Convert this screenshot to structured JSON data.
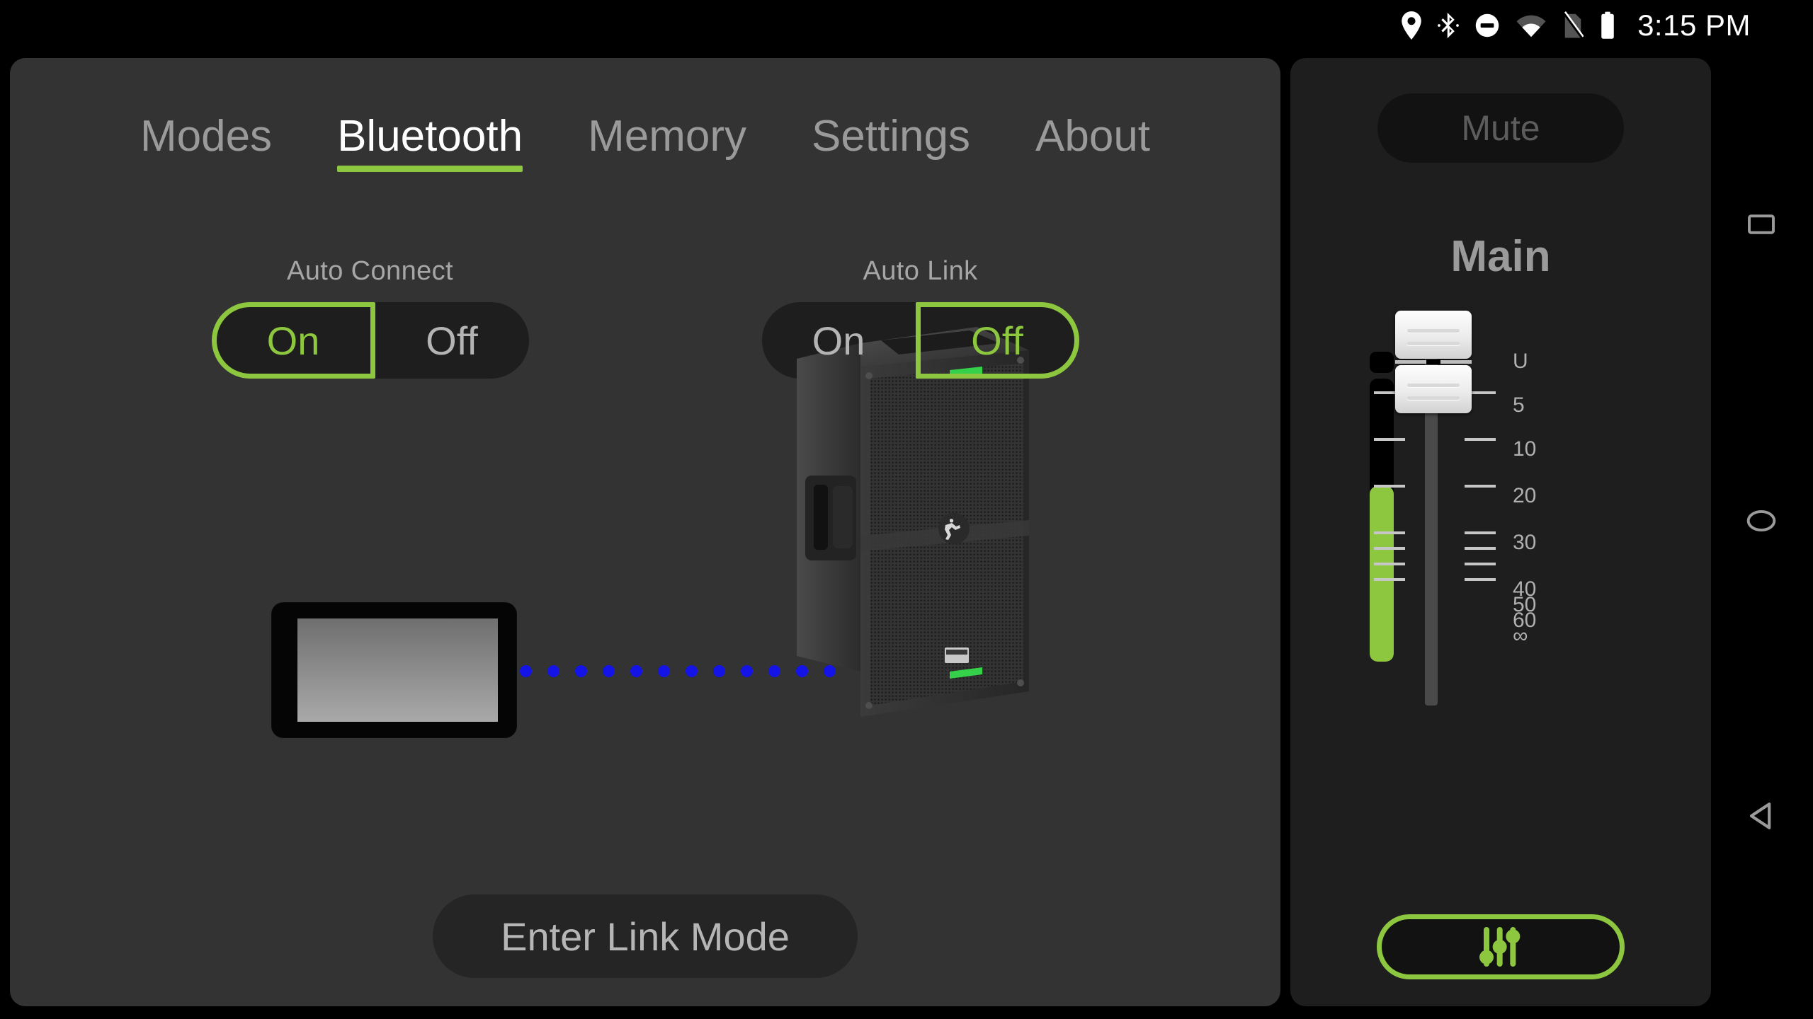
{
  "statusbar": {
    "time": "3:15 PM",
    "icons": [
      {
        "name": "location-icon",
        "label": "location"
      },
      {
        "name": "bluetooth-icon",
        "label": "bluetooth"
      },
      {
        "name": "do-not-disturb-icon",
        "label": "do not disturb"
      },
      {
        "name": "wifi-icon",
        "label": "wifi"
      },
      {
        "name": "no-sim-icon",
        "label": "no sim"
      },
      {
        "name": "battery-icon",
        "label": "battery"
      }
    ]
  },
  "tabs": [
    {
      "label": "Modes",
      "active": false
    },
    {
      "label": "Bluetooth",
      "active": true
    },
    {
      "label": "Memory",
      "active": false
    },
    {
      "label": "Settings",
      "active": false
    },
    {
      "label": "About",
      "active": false
    }
  ],
  "toggles": [
    {
      "caption": "Auto Connect",
      "options": [
        "On",
        "Off"
      ],
      "selected": "On"
    },
    {
      "caption": "Auto Link",
      "options": [
        "On",
        "Off"
      ],
      "selected": "Off"
    }
  ],
  "illustration": {
    "device_name": "tablet-device",
    "speaker_name": "powered-speaker",
    "speaker_brand": "Mackie",
    "connection": "bluetooth-dotted-link",
    "dot_count": 12,
    "dot_color": "#1414e6"
  },
  "link_button": {
    "label": "Enter Link Mode"
  },
  "channel_strip": {
    "mute_label": "Mute",
    "channel_name": "Main",
    "fader_value_label": "U",
    "meter_level_percent": 62,
    "scale_labels": [
      "U",
      "5",
      "10",
      "20",
      "30",
      "40",
      "50",
      "60",
      "∞"
    ],
    "eq_button_name": "eq-sliders-button"
  },
  "navbar": [
    {
      "name": "recents-icon",
      "label": "Recents"
    },
    {
      "name": "home-icon",
      "label": "Home"
    },
    {
      "name": "back-icon",
      "label": "Back"
    }
  ],
  "colors": {
    "accent_green": "#8DC63F",
    "panel_left": "#333333",
    "panel_right": "#1e1e1e",
    "text_muted": "#9a9a9a"
  }
}
